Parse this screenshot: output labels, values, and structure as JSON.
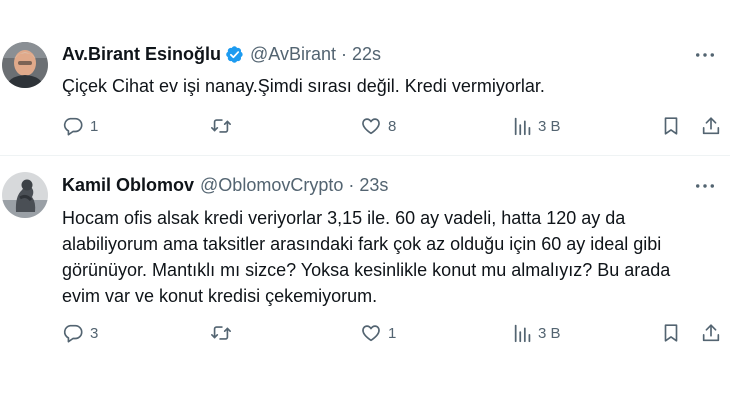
{
  "tweets": [
    {
      "name": "Av.Birant Esinoğlu",
      "handle": "@AvBirant",
      "separator": "·",
      "time": "22s",
      "verified": true,
      "text": "Çiçek Cihat ev işi nanay.Şimdi sırası değil. Kredi vermiyorlar.",
      "reply_count": "1",
      "retweet_count": "",
      "like_count": "8",
      "view_count": "3 B"
    },
    {
      "name": "Kamil Oblomov",
      "handle": "@OblomovCrypto",
      "separator": "·",
      "time": "23s",
      "verified": false,
      "text": "Hocam ofis alsak kredi veriyorlar 3,15 ile. 60 ay vadeli, hatta 120 ay da alabiliyorum ama taksitler arasındaki fark çok az olduğu için 60 ay ideal gibi görünüyor. Mantıklı mı sizce? Yoksa kesinlikle konut mu almalıyız? Bu arada evim var ve konut kredisi çekemiyorum.",
      "reply_count": "3",
      "retweet_count": "",
      "like_count": "1",
      "view_count": "3 B"
    }
  ],
  "icons": {
    "reply": "reply-icon",
    "retweet": "retweet-icon",
    "like": "heart-icon",
    "views": "views-icon",
    "bookmark": "bookmark-icon",
    "share": "share-icon",
    "more": "more-icon",
    "verified": "verified-badge-icon"
  },
  "colors": {
    "text": "#0f1419",
    "secondary": "#536471",
    "verified": "#1d9bf0",
    "divider": "#eff3f4"
  }
}
